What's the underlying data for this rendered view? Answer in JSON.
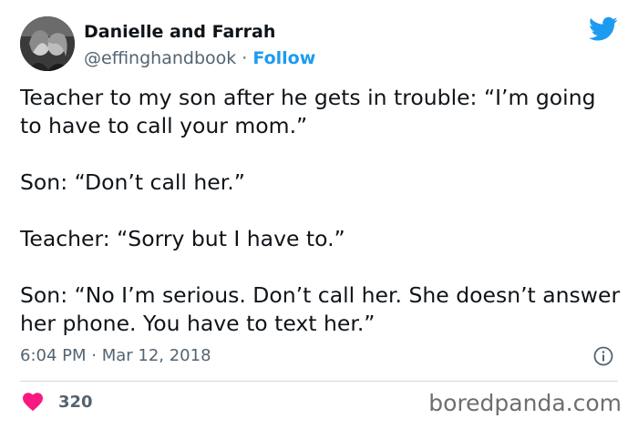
{
  "author": {
    "display_name": "Danielle and Farrah",
    "handle": "@effinghandbook",
    "separator": " · ",
    "follow_label": "Follow"
  },
  "icons": {
    "avatar": "avatar-photo",
    "brand": "twitter-bird-icon",
    "info": "info-icon",
    "like": "heart-icon"
  },
  "body": {
    "paragraphs": [
      "Teacher to my son after he gets in trouble: “I’m going to have to call your mom.”",
      "Son: “Don’t call her.”",
      "Teacher: “Sorry but I have to.”",
      "Son: “No I’m serious. Don’t call her. She doesn’t answer her phone. You have to text her.”"
    ]
  },
  "meta": {
    "time": "6:04 PM",
    "separator": " · ",
    "date": "Mar 12, 2018"
  },
  "engagement": {
    "likes": "320"
  },
  "watermark": "boredpanda.com",
  "colors": {
    "accent": "#1d9bf0",
    "heart": "#f91880",
    "text": "#0f1419",
    "muted": "#536471"
  }
}
